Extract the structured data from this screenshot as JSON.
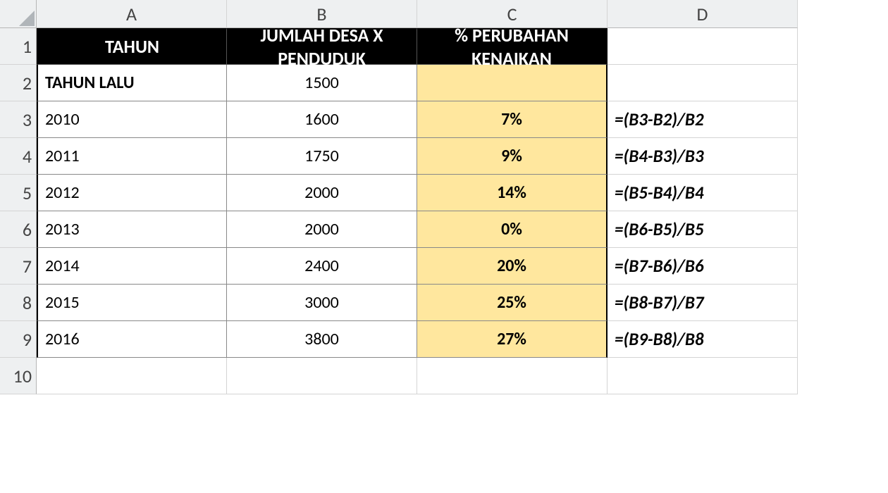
{
  "columns": [
    "A",
    "B",
    "C",
    "D"
  ],
  "headerRow": {
    "A": "TAHUN",
    "B": "JUMLAH DESA X PENDUDUK",
    "C": "% PERUBAHAN KENAIKAN"
  },
  "rows": [
    {
      "num": "1"
    },
    {
      "num": "2",
      "A": "TAHUN LALU",
      "B": "1500",
      "C": "",
      "D": ""
    },
    {
      "num": "3",
      "A": "2010",
      "B": "1600",
      "C": "7%",
      "D": "=(B3-B2)/B2"
    },
    {
      "num": "4",
      "A": "2011",
      "B": "1750",
      "C": "9%",
      "D": "=(B4-B3)/B3"
    },
    {
      "num": "5",
      "A": "2012",
      "B": "2000",
      "C": "14%",
      "D": "=(B5-B4)/B4"
    },
    {
      "num": "6",
      "A": "2013",
      "B": "2000",
      "C": "0%",
      "D": "=(B6-B5)/B5"
    },
    {
      "num": "7",
      "A": "2014",
      "B": "2400",
      "C": "20%",
      "D": "=(B7-B6)/B6"
    },
    {
      "num": "8",
      "A": "2015",
      "B": "3000",
      "C": "25%",
      "D": "=(B8-B7)/B7"
    },
    {
      "num": "9",
      "A": "2016",
      "B": "3800",
      "C": "27%",
      "D": "=(B9-B8)/B8"
    },
    {
      "num": "10"
    }
  ]
}
